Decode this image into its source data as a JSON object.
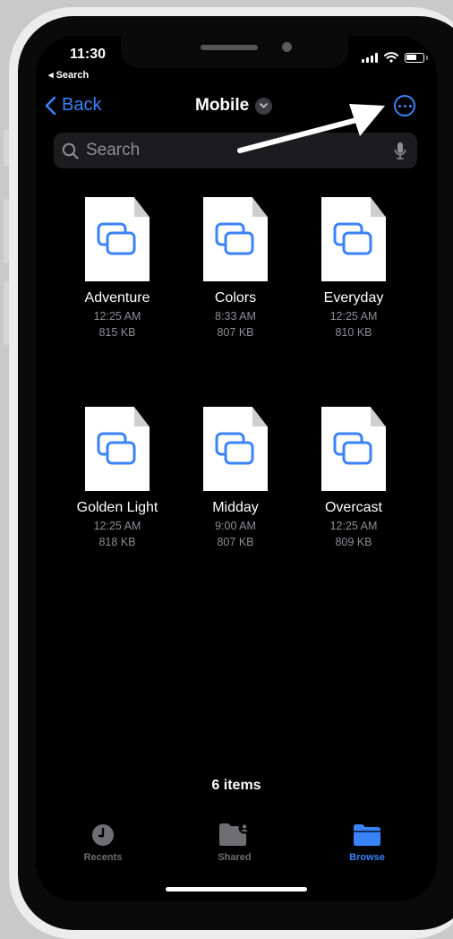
{
  "status_bar": {
    "time": "11:30",
    "back_to_app": "◂ Search"
  },
  "nav": {
    "back_label": "Back",
    "title": "Mobile"
  },
  "search": {
    "placeholder": "Search"
  },
  "files": [
    {
      "name": "Adventure",
      "time": "12:25 AM",
      "size": "815 KB"
    },
    {
      "name": "Colors",
      "time": "8:33 AM",
      "size": "807 KB"
    },
    {
      "name": "Everyday",
      "time": "12:25 AM",
      "size": "810 KB"
    },
    {
      "name": "Golden Light",
      "time": "12:25 AM",
      "size": "818 KB"
    },
    {
      "name": "Midday",
      "time": "9:00 AM",
      "size": "807 KB"
    },
    {
      "name": "Overcast",
      "time": "12:25 AM",
      "size": "809 KB"
    }
  ],
  "item_count": "6 items",
  "tabs": [
    {
      "label": "Recents",
      "icon": "clock-icon",
      "active": false
    },
    {
      "label": "Shared",
      "icon": "shared-folder-icon",
      "active": false
    },
    {
      "label": "Browse",
      "icon": "folder-icon",
      "active": true
    }
  ],
  "colors": {
    "accent": "#3a82f7",
    "inactive_tab": "#6e6e73",
    "secondary_text": "#8e8e93"
  }
}
